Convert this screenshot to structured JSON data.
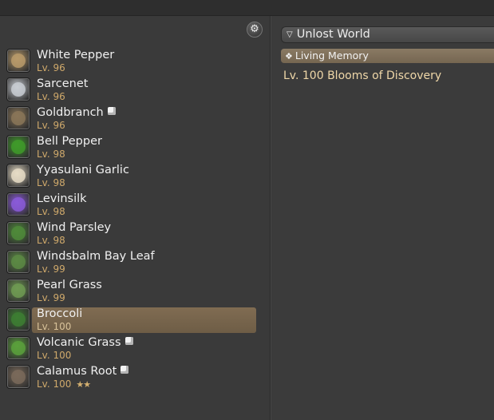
{
  "settings_icon": "gear-icon",
  "items": [
    {
      "name": "White Pepper",
      "level": "Lv. 96",
      "icon_color": "#b89a6a",
      "badge": false,
      "stars": ""
    },
    {
      "name": "Sarcenet",
      "level": "Lv. 96",
      "icon_color": "#c8ccd2",
      "badge": false,
      "stars": ""
    },
    {
      "name": "Goldbranch",
      "level": "Lv. 96",
      "icon_color": "#8a7658",
      "badge": true,
      "stars": ""
    },
    {
      "name": "Bell Pepper",
      "level": "Lv. 98",
      "icon_color": "#3f9a2a",
      "badge": false,
      "stars": ""
    },
    {
      "name": "Yyasulani Garlic",
      "level": "Lv. 98",
      "icon_color": "#e6dcc6",
      "badge": false,
      "stars": ""
    },
    {
      "name": "Levinsilk",
      "level": "Lv. 98",
      "icon_color": "#8a5ad8",
      "badge": false,
      "stars": ""
    },
    {
      "name": "Wind Parsley",
      "level": "Lv. 98",
      "icon_color": "#4f8a3a",
      "badge": false,
      "stars": ""
    },
    {
      "name": "Windsbalm Bay Leaf",
      "level": "Lv. 99",
      "icon_color": "#5c8a44",
      "badge": false,
      "stars": ""
    },
    {
      "name": "Pearl Grass",
      "level": "Lv. 99",
      "icon_color": "#6e9a52",
      "badge": false,
      "stars": ""
    },
    {
      "name": "Broccoli",
      "level": "Lv. 100",
      "icon_color": "#3d7e32",
      "badge": false,
      "stars": "",
      "selected": true
    },
    {
      "name": "Volcanic Grass",
      "level": "Lv. 100",
      "icon_color": "#5aa03c",
      "badge": true,
      "stars": ""
    },
    {
      "name": "Calamus Root",
      "level": "Lv. 100",
      "icon_color": "#7a6a5a",
      "badge": true,
      "stars": "★★"
    }
  ],
  "details": {
    "header": "Unlost World",
    "memory_label": "Living Memory",
    "discovery": "Lv. 100 Blooms of Discovery"
  }
}
